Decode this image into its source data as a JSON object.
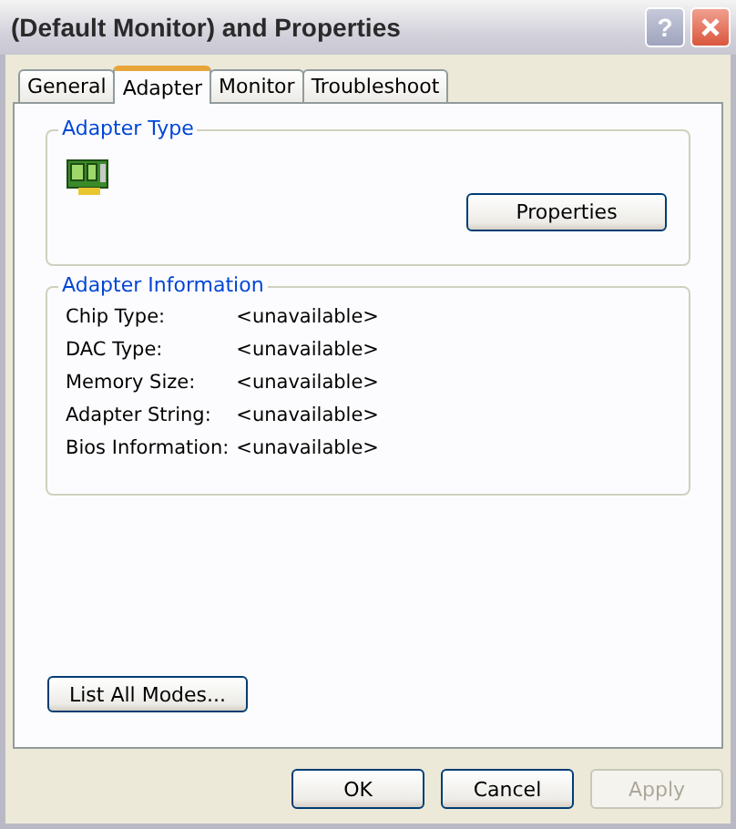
{
  "window": {
    "title": "(Default Monitor) and  Properties",
    "help_button": "?"
  },
  "tabs": [
    {
      "label": "General",
      "selected": false
    },
    {
      "label": "Adapter",
      "selected": true
    },
    {
      "label": "Monitor",
      "selected": false
    },
    {
      "label": "Troubleshoot",
      "selected": false
    }
  ],
  "adapter_type": {
    "label": "Adapter Type",
    "button": "Properties"
  },
  "adapter_information": {
    "label": "Adapter Information",
    "rows": [
      {
        "label": "Chip Type:",
        "value": "<unavailable>"
      },
      {
        "label": "DAC Type:",
        "value": "<unavailable>"
      },
      {
        "label": "Memory Size:",
        "value": "<unavailable>"
      },
      {
        "label": "Adapter String:",
        "value": "<unavailable>"
      },
      {
        "label": "Bios Information:",
        "value": "<unavailable>"
      }
    ]
  },
  "list_modes_button": "List All Modes...",
  "buttons": [
    {
      "label": "OK",
      "disabled": false
    },
    {
      "label": "Cancel",
      "disabled": false
    },
    {
      "label": "Apply",
      "disabled": true
    }
  ]
}
